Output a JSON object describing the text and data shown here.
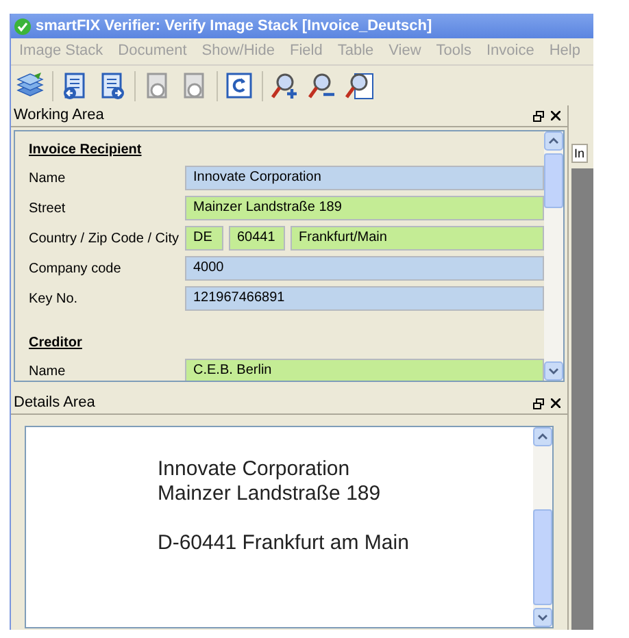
{
  "window": {
    "title": "smartFIX Verifier: Verify Image Stack [Invoice_Deutsch]"
  },
  "menu": [
    {
      "label": "Image Stack",
      "disabled": true
    },
    {
      "label": "Document",
      "disabled": true
    },
    {
      "label": "Show/Hide",
      "disabled": true
    },
    {
      "label": "Field",
      "disabled": true
    },
    {
      "label": "Table",
      "disabled": true
    },
    {
      "label": "View",
      "disabled": true
    },
    {
      "label": "Tools",
      "disabled": true
    },
    {
      "label": "Invoice",
      "disabled": true
    },
    {
      "label": "Help",
      "disabled": true
    }
  ],
  "toolbar": [
    {
      "kind": "stack",
      "disabled": false
    },
    {
      "kind": "prev-doc",
      "disabled": false
    },
    {
      "kind": "next-doc",
      "disabled": false
    },
    {
      "kind": "prev-page",
      "disabled": true
    },
    {
      "kind": "next-page",
      "disabled": true
    },
    {
      "kind": "rotate",
      "disabled": false
    },
    {
      "kind": "zoom-in",
      "disabled": false
    },
    {
      "kind": "zoom-out",
      "disabled": false
    },
    {
      "kind": "zoom-fit",
      "disabled": false
    }
  ],
  "working_area": {
    "title": "Working Area",
    "sections": [
      {
        "heading": "Invoice Recipient",
        "rows": [
          {
            "label": "Name",
            "fields": [
              {
                "value": "Innovate Corporation",
                "verified": false
              }
            ]
          },
          {
            "label": "Street",
            "fields": [
              {
                "value": "Mainzer Landstraße 189",
                "verified": true
              }
            ]
          },
          {
            "label": "Country / Zip Code / City",
            "fields": [
              {
                "value": "DE",
                "verified": true
              },
              {
                "value": "60441",
                "verified": true
              },
              {
                "value": "Frankfurt/Main",
                "verified": true
              }
            ]
          },
          {
            "label": "Company code",
            "fields": [
              {
                "value": "4000",
                "verified": false
              }
            ]
          },
          {
            "label": "Key No.",
            "fields": [
              {
                "value": "121967466891",
                "verified": false
              }
            ]
          }
        ]
      },
      {
        "heading": "Creditor",
        "rows": [
          {
            "label": "Name",
            "fields": [
              {
                "value": "C.E.B. Berlin",
                "verified": true
              }
            ]
          }
        ]
      }
    ]
  },
  "side_panel": {
    "tab": "In"
  },
  "details_area": {
    "title": "Details Area",
    "document_blocks": [
      [
        "Innovate Corporation",
        "Mainzer Landstraße 189"
      ],
      [
        "D-60441 Frankfurt am Main"
      ]
    ]
  }
}
